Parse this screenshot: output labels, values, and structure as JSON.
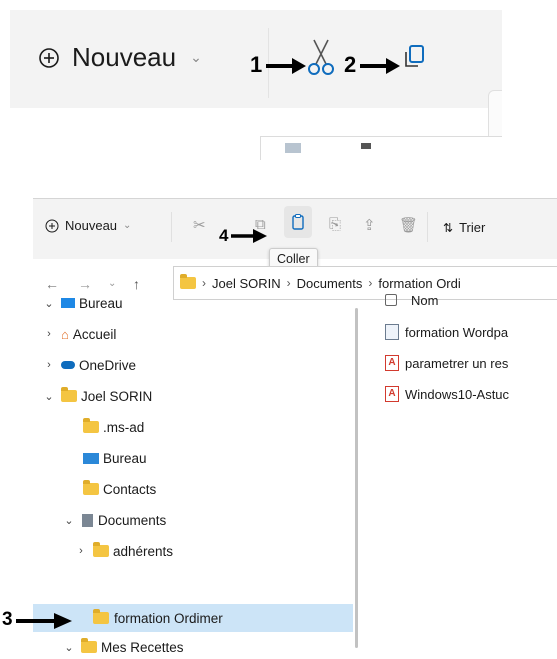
{
  "top_toolbar": {
    "new_label": "Nouveau",
    "annotation_1": "1",
    "annotation_2": "2"
  },
  "toolbar": {
    "new_label": "Nouveau",
    "sort_label": "Trier",
    "annotation_4": "4",
    "tooltip": "Coller"
  },
  "address": {
    "segments": [
      "Joel SORIN",
      "Documents",
      "formation Ordi"
    ]
  },
  "tree": {
    "bureau": "Bureau",
    "accueil": "Accueil",
    "onedrive": "OneDrive",
    "joel": "Joel SORIN",
    "msad": ".ms-ad",
    "bureau2": "Bureau",
    "contacts": "Contacts",
    "documents": "Documents",
    "adherents": "adhérents",
    "formation": "formation Ordimer",
    "recettes": "Mes Recettes"
  },
  "annotation_3": "3",
  "files": {
    "header": "Nom",
    "items": [
      "formation Wordpa",
      "parametrer un res",
      "Windows10-Astuc"
    ]
  },
  "colors": {
    "selection": "#cce4f7",
    "folder": "#f4c542",
    "accent_blue": "#0f6cbd"
  }
}
